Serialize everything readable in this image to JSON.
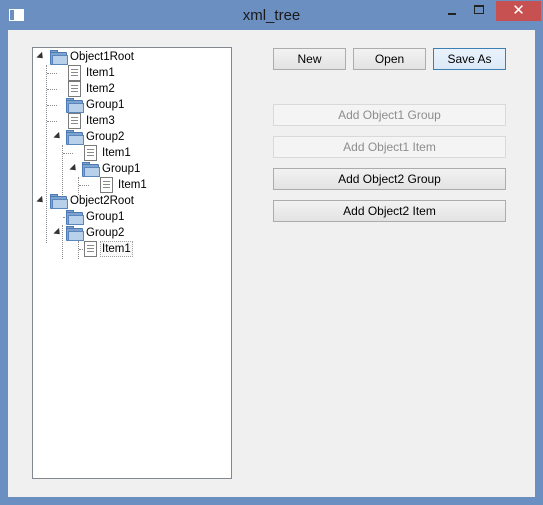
{
  "window": {
    "title": "xml_tree"
  },
  "tree": {
    "nodes": [
      {
        "label": "Object1Root",
        "icon": "folder-icon",
        "expanded": true
      },
      {
        "label": "Item1",
        "icon": "document-icon"
      },
      {
        "label": "Item2",
        "icon": "document-icon"
      },
      {
        "label": "Group1",
        "icon": "folder-icon"
      },
      {
        "label": "Item3",
        "icon": "document-icon"
      },
      {
        "label": "Group2",
        "icon": "folder-icon",
        "expanded": true
      },
      {
        "label": "Item1",
        "icon": "document-icon"
      },
      {
        "label": "Group1",
        "icon": "folder-icon",
        "expanded": true
      },
      {
        "label": "Item1",
        "icon": "document-icon"
      },
      {
        "label": "Object2Root",
        "icon": "folder-icon",
        "expanded": true
      },
      {
        "label": "Group1",
        "icon": "folder-icon"
      },
      {
        "label": "Group2",
        "icon": "folder-icon",
        "expanded": true
      },
      {
        "label": "Item1",
        "icon": "document-icon",
        "selected": true
      }
    ]
  },
  "toolbar": {
    "new_label": "New",
    "open_label": "Open",
    "save_as_label": "Save As"
  },
  "actions": {
    "add_object1_group": {
      "label": "Add Object1 Group",
      "enabled": false
    },
    "add_object1_item": {
      "label": "Add Object1 Item",
      "enabled": false
    },
    "add_object2_group": {
      "label": "Add Object2 Group",
      "enabled": true
    },
    "add_object2_item": {
      "label": "Add Object2 Item",
      "enabled": true
    }
  },
  "colors": {
    "title_bar": "#6b8fc0",
    "close_button": "#c75050",
    "client_background": "#f0f0f0"
  }
}
